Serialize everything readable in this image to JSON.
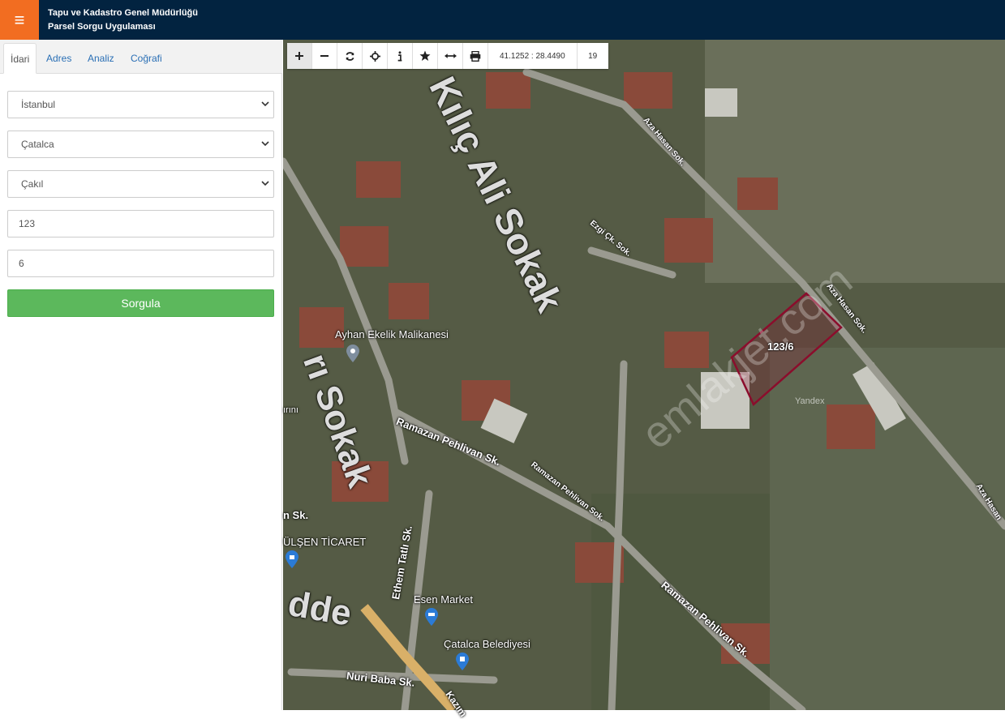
{
  "header": {
    "menu_icon": "hamburger-icon",
    "title_line1": "Tapu ve Kadastro Genel Müdürlüğü",
    "title_line2": "Parsel Sorgu Uygulaması",
    "accent_color": "#f26d21",
    "bar_color": "#022340"
  },
  "tabs": [
    {
      "label": "İdari",
      "active": true
    },
    {
      "label": "Adres",
      "active": false
    },
    {
      "label": "Analiz",
      "active": false
    },
    {
      "label": "Coğrafi",
      "active": false
    }
  ],
  "form": {
    "il": "İstanbul",
    "ilce": "Çatalca",
    "mahalle": "Çakıl",
    "ada": "123",
    "parsel": "6",
    "submit_label": "Sorgula",
    "submit_color": "#5cb85c"
  },
  "toolbar": {
    "tools": [
      "zoom-in-icon",
      "zoom-out-icon",
      "refresh-icon",
      "crosshair-icon",
      "info-icon",
      "star-icon",
      "measure-icon",
      "print-icon"
    ],
    "coordinates": "41.1252 : 28.4490",
    "zoom_level": "19"
  },
  "map": {
    "parcel_label": "123/6",
    "parcel_color": "#8b0d2c",
    "attribution": "Yandex",
    "watermark": "emlakjet.com",
    "streets": {
      "kilic": "Kılıç Ali Sokak",
      "aza1": "Aza Hasan Sok.",
      "aza2": "Aza Hasan Sok.",
      "aza3": "Aza Hasan",
      "ezgi": "Ezgi Çk. Sok.",
      "ramazan1": "Ramazan Pehlivan Sk.",
      "ramazan2": "Ramazan Pehlivan Sok.",
      "ramazan3": "Ramazan Pehlivan Sk.",
      "ethem": "Ethem Tatlı Sk.",
      "nuri": "Nuri Baba Sk.",
      "sokak_left": "rı Sokak",
      "irini": "ırını",
      "nsk": "n Sk.",
      "kazim": "Kazım",
      "cadde": "dde"
    },
    "pois": {
      "ayhan": "Ayhan Ekelik Malikanesi",
      "gulsen": "ÜLŞEN TİCARET",
      "esen": "Esen Market",
      "belediye": "Çatalca Belediyesi"
    }
  }
}
